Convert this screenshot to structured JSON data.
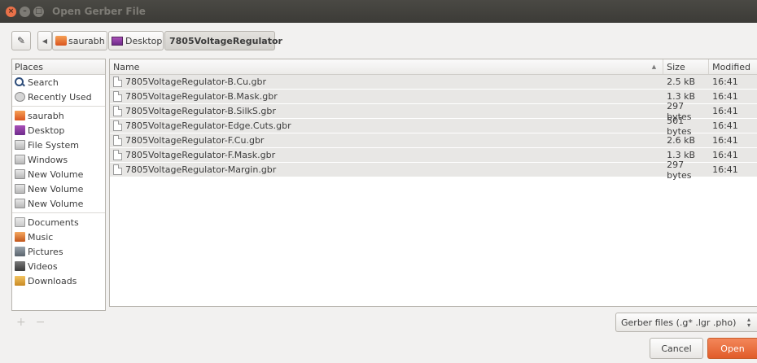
{
  "window": {
    "title": "Open Gerber File"
  },
  "toolbar": {
    "breadcrumbs": [
      "saurabh",
      "Desktop",
      "7805VoltageRegulator"
    ]
  },
  "places": {
    "header": "Places",
    "items": [
      {
        "label": "Search",
        "icon": "search-icon"
      },
      {
        "label": "Recently Used",
        "icon": "recent-icon"
      },
      {
        "label": "saurabh",
        "icon": "home-folder-icon"
      },
      {
        "label": "Desktop",
        "icon": "desktop-icon"
      },
      {
        "label": "File System",
        "icon": "drive-icon"
      },
      {
        "label": "Windows",
        "icon": "drive-icon"
      },
      {
        "label": "New Volume",
        "icon": "drive-icon"
      },
      {
        "label": "New Volume",
        "icon": "drive-icon"
      },
      {
        "label": "New Volume",
        "icon": "drive-icon"
      },
      {
        "label": "Documents",
        "icon": "documents-icon"
      },
      {
        "label": "Music",
        "icon": "music-icon"
      },
      {
        "label": "Pictures",
        "icon": "pictures-icon"
      },
      {
        "label": "Videos",
        "icon": "videos-icon"
      },
      {
        "label": "Downloads",
        "icon": "downloads-icon"
      }
    ]
  },
  "files": {
    "columns": {
      "name": "Name",
      "size": "Size",
      "modified": "Modified"
    },
    "rows": [
      {
        "name": "7805VoltageRegulator-B.Cu.gbr",
        "size": "2.5 kB",
        "modified": "16:41"
      },
      {
        "name": "7805VoltageRegulator-B.Mask.gbr",
        "size": "1.3 kB",
        "modified": "16:41"
      },
      {
        "name": "7805VoltageRegulator-B.SilkS.gbr",
        "size": "297 bytes",
        "modified": "16:41"
      },
      {
        "name": "7805VoltageRegulator-Edge.Cuts.gbr",
        "size": "501 bytes",
        "modified": "16:41"
      },
      {
        "name": "7805VoltageRegulator-F.Cu.gbr",
        "size": "2.6 kB",
        "modified": "16:41"
      },
      {
        "name": "7805VoltageRegulator-F.Mask.gbr",
        "size": "1.3 kB",
        "modified": "16:41"
      },
      {
        "name": "7805VoltageRegulator-Margin.gbr",
        "size": "297 bytes",
        "modified": "16:41"
      }
    ]
  },
  "filter": {
    "selected": "Gerber files (.g* .lgr .pho)"
  },
  "actions": {
    "cancel": "Cancel",
    "open": "Open"
  },
  "colors": {
    "accent": "#e15c2a",
    "titlebar": "#3c3b37",
    "row_bg": "#e8e7e5"
  }
}
